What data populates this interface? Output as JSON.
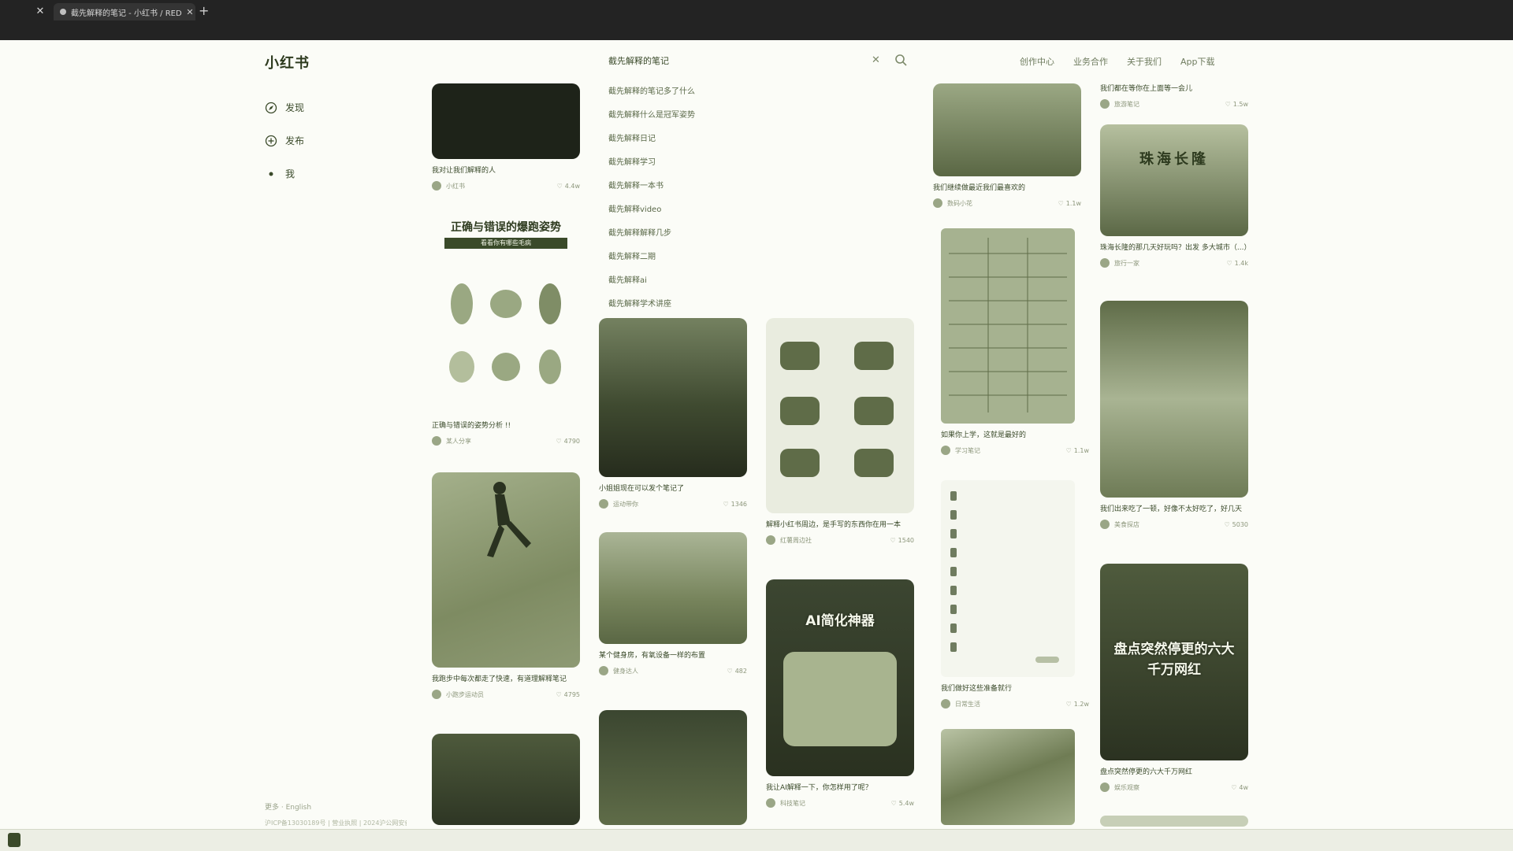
{
  "browser": {
    "tab_title": "截先解释的笔记 - 小红书 / RED",
    "new_tab_label": "+"
  },
  "header": {
    "logo": "小红书",
    "search_value": "截先解释的笔记",
    "nav": [
      "创作中心",
      "业务合作",
      "关于我们",
      "App下载"
    ]
  },
  "sidebar": {
    "items": [
      {
        "label": "发现",
        "icon": "compass-icon"
      },
      {
        "label": "发布",
        "icon": "plus-circle-icon"
      },
      {
        "label": "我",
        "icon": "user-dot-icon"
      }
    ],
    "footer_1": "更多 · English",
    "footer_2": "沪ICP备13030189号 | 营业执照 | 2024沪公网安备"
  },
  "suggestions": [
    "截先解释的笔记多了什么",
    "截先解释什么是冠军姿势",
    "截先解释日记",
    "截先解释学习",
    "截先解释一本书",
    "截先解释video",
    "截先解释解释几步",
    "截先解释二期",
    "截先解释ai",
    "截先解释学术讲座"
  ],
  "cards": [
    {
      "title": "我对让我们解释的人",
      "author": "小红书",
      "likes": "4.4w",
      "thumb_text": ""
    },
    {
      "title": "正确与错误的姿势分析 !!",
      "author": "某人分享",
      "likes": "4790",
      "thumb_text": "正确与错误的爆跑姿势",
      "thumb_sub": "看看你有哪些毛病"
    },
    {
      "title": "我跑步中每次都走了快速，有道理解释笔记",
      "author": "小跑步运动员",
      "likes": "4795",
      "thumb_text": ""
    },
    {
      "title": "",
      "author": "",
      "likes": "",
      "thumb_text": ""
    },
    {
      "title": "小姐姐现在可以发个笔记了",
      "author": "运动带你",
      "likes": "1346",
      "thumb_text": ""
    },
    {
      "title": "某个健身房，有氧设备一样的布置",
      "author": "健身达人",
      "likes": "482",
      "thumb_text": ""
    },
    {
      "title": "",
      "author": "",
      "likes": "",
      "thumb_text": ""
    },
    {
      "title": "解释小红书周边，是手写的东西你在用一本",
      "author": "红薯周边社",
      "likes": "1540",
      "thumb_text": ""
    },
    {
      "title": "我让AI解释一下，你怎样用了呢？",
      "author": "科技笔记",
      "likes": "5.4w",
      "thumb_text": "AI简化神器"
    },
    {
      "title": "我们继续做最近我们最喜欢的",
      "author": "数码小花",
      "likes": "1.1w",
      "thumb_text": ""
    },
    {
      "title": "如果你上学，这就是最好的",
      "author": "学习笔记",
      "likes": "1.1w",
      "thumb_text": ""
    },
    {
      "title": "我们做好这些准备就行",
      "author": "日常生活",
      "likes": "1.2w",
      "thumb_text": ""
    },
    {
      "title": "",
      "author": "",
      "likes": "",
      "thumb_text": ""
    },
    {
      "title": "我们都在等你在上面等一会儿",
      "author": "旅游笔记",
      "likes": "1.5w",
      "thumb_text": ""
    },
    {
      "title": "珠海长隆的那几天好玩吗？出发 多大城市（...）",
      "author": "旅行一家",
      "likes": "1.4k",
      "thumb_text": "珠海长隆"
    },
    {
      "title": "我们出来吃了一顿，好像不太好吃了，好几天",
      "author": "美食探店",
      "likes": "5030",
      "thumb_text": ""
    },
    {
      "title": "盘点突然停更的六大千万网红",
      "author": "娱乐观察",
      "likes": "4w",
      "thumb_text": "盘点突然停更的六大千万网红"
    }
  ]
}
